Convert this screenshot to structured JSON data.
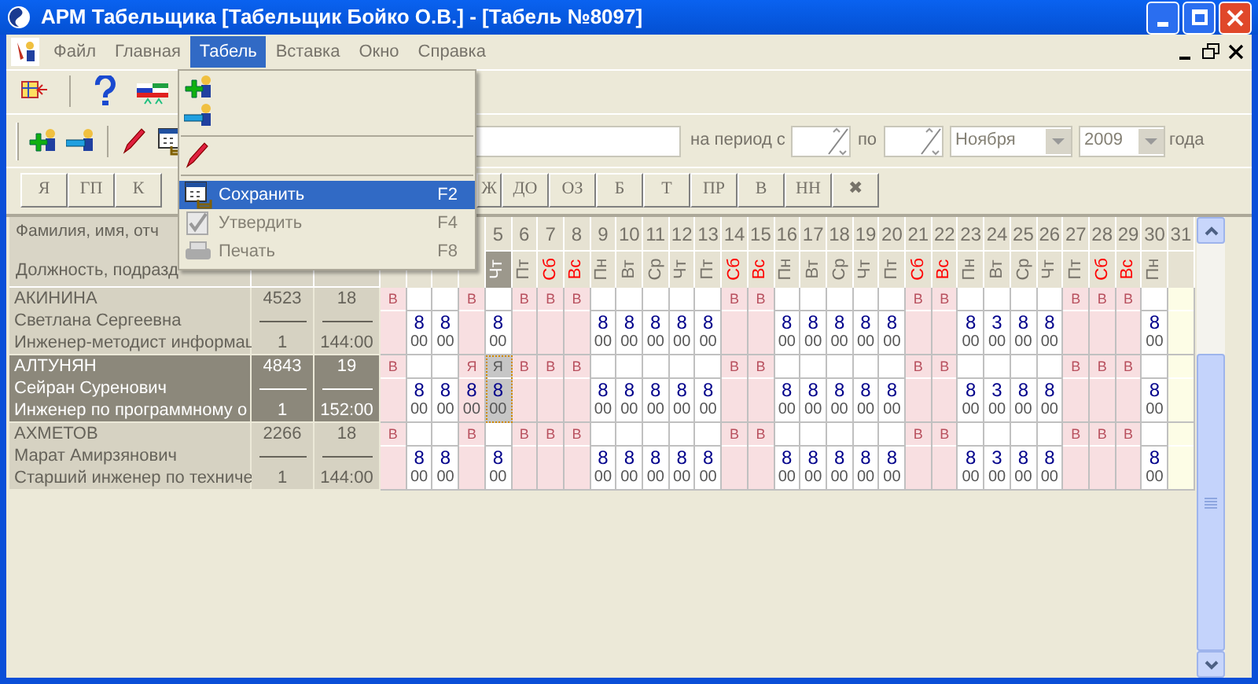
{
  "window": {
    "title": "АРМ Табельщика [Табельщик Бойко О.В.] - [Табель №8097]"
  },
  "menu": [
    {
      "label": "Файл",
      "selected": false
    },
    {
      "label": "Главная",
      "selected": false
    },
    {
      "label": "Табель",
      "selected": true
    },
    {
      "label": "Вставка",
      "selected": false
    },
    {
      "label": "Окно",
      "selected": false
    },
    {
      "label": "Справка",
      "selected": false
    }
  ],
  "dropdown": {
    "items": [
      {
        "kind": "item",
        "selected": false
      },
      {
        "kind": "item",
        "selected": false
      },
      {
        "kind": "separator"
      },
      {
        "kind": "item",
        "selected": false
      },
      {
        "kind": "separator"
      },
      {
        "kind": "item",
        "label": "Сохранить",
        "shortcut": "F2",
        "selected": true,
        "disabled": false
      },
      {
        "kind": "item",
        "label": "Утвердить",
        "shortcut": "F4",
        "selected": false,
        "disabled": true
      },
      {
        "kind": "item",
        "label": "Печать",
        "shortcut": "F8",
        "selected": false,
        "disabled": true
      }
    ]
  },
  "period": {
    "from_label": "на период с",
    "to_label": "по",
    "month": "Ноября",
    "year": "2009",
    "suffix": "года"
  },
  "codes_left": [
    "Я",
    "ГП",
    "К"
  ],
  "codes_right": [
    "Ж",
    "ДО",
    "ОЗ",
    "Б",
    "Т",
    "ПР",
    "В",
    "НН",
    "✖"
  ],
  "grid": {
    "header": {
      "name_label": "Фамилия, имя, отч",
      "position_label": "Должность, подразд",
      "days": [
        {
          "day": "5",
          "weekday": "Чт",
          "weekend": false,
          "selected": true
        },
        {
          "day": "6",
          "weekday": "Пт",
          "weekend": false,
          "selected": false
        },
        {
          "day": "7",
          "weekday": "Сб",
          "weekend": true,
          "selected": false
        },
        {
          "day": "8",
          "weekday": "Вс",
          "weekend": true,
          "selected": false
        },
        {
          "day": "9",
          "weekday": "Пн",
          "weekend": false,
          "selected": false
        },
        {
          "day": "10",
          "weekday": "Вт",
          "weekend": false,
          "selected": false
        },
        {
          "day": "11",
          "weekday": "Ср",
          "weekend": false,
          "selected": false
        },
        {
          "day": "12",
          "weekday": "Чт",
          "weekend": false,
          "selected": false
        },
        {
          "day": "13",
          "weekday": "Пт",
          "weekend": false,
          "selected": false
        },
        {
          "day": "14",
          "weekday": "Сб",
          "weekend": true,
          "selected": false
        },
        {
          "day": "15",
          "weekday": "Вс",
          "weekend": true,
          "selected": false
        },
        {
          "day": "16",
          "weekday": "Пн",
          "weekend": false,
          "selected": false
        },
        {
          "day": "17",
          "weekday": "Вт",
          "weekend": false,
          "selected": false
        },
        {
          "day": "18",
          "weekday": "Ср",
          "weekend": false,
          "selected": false
        },
        {
          "day": "19",
          "weekday": "Чт",
          "weekend": false,
          "selected": false
        },
        {
          "day": "20",
          "weekday": "Пт",
          "weekend": false,
          "selected": false
        },
        {
          "day": "21",
          "weekday": "Сб",
          "weekend": true,
          "selected": false
        },
        {
          "day": "22",
          "weekday": "Вс",
          "weekend": true,
          "selected": false
        },
        {
          "day": "23",
          "weekday": "Пн",
          "weekend": false,
          "selected": false
        },
        {
          "day": "24",
          "weekday": "Вт",
          "weekend": false,
          "selected": false
        },
        {
          "day": "25",
          "weekday": "Ср",
          "weekend": false,
          "selected": false
        },
        {
          "day": "26",
          "weekday": "Чт",
          "weekend": false,
          "selected": false
        },
        {
          "day": "27",
          "weekday": "Пт",
          "weekend": false,
          "selected": false
        },
        {
          "day": "28",
          "weekday": "Сб",
          "weekend": true,
          "selected": false
        },
        {
          "day": "29",
          "weekday": "Вс",
          "weekend": true,
          "selected": false
        },
        {
          "day": "30",
          "weekday": "Пн",
          "weekend": false,
          "selected": false
        },
        {
          "day": "31",
          "selected": false
        }
      ]
    },
    "employees": [
      {
        "surname": "АКИНИНА",
        "name": "Светлана Сергеевна",
        "position": "Инженер-методист информац",
        "tab_number": "4523",
        "rate": "1",
        "days": "18",
        "hours": "144:00",
        "selected": false,
        "cells": [
          {
            "kind": "off",
            "mark": "В",
            "selected": false
          },
          {
            "kind": "work",
            "hours": "8",
            "minutes": "00",
            "selected": false
          },
          {
            "kind": "work",
            "hours": "8",
            "minutes": "00",
            "selected": false
          },
          {
            "kind": "off",
            "mark": "В",
            "selected": false
          },
          {
            "kind": "work",
            "hours": "8",
            "minutes": "00",
            "selected": false
          },
          {
            "kind": "off",
            "mark": "В",
            "selected": false
          },
          {
            "kind": "off",
            "mark": "В",
            "selected": false
          },
          {
            "kind": "off",
            "mark": "В",
            "selected": false
          },
          {
            "kind": "work",
            "hours": "8",
            "minutes": "00",
            "selected": false
          },
          {
            "kind": "work",
            "hours": "8",
            "minutes": "00",
            "selected": false
          },
          {
            "kind": "work",
            "hours": "8",
            "minutes": "00",
            "selected": false
          },
          {
            "kind": "work",
            "hours": "8",
            "minutes": "00",
            "selected": false
          },
          {
            "kind": "work",
            "hours": "8",
            "minutes": "00",
            "selected": false
          },
          {
            "kind": "off",
            "mark": "В",
            "selected": false
          },
          {
            "kind": "off",
            "mark": "В",
            "selected": false
          },
          {
            "kind": "work",
            "hours": "8",
            "minutes": "00",
            "selected": false
          },
          {
            "kind": "work",
            "hours": "8",
            "minutes": "00",
            "selected": false
          },
          {
            "kind": "work",
            "hours": "8",
            "minutes": "00",
            "selected": false
          },
          {
            "kind": "work",
            "hours": "8",
            "minutes": "00",
            "selected": false
          },
          {
            "kind": "work",
            "hours": "8",
            "minutes": "00",
            "selected": false
          },
          {
            "kind": "off",
            "mark": "В",
            "selected": false
          },
          {
            "kind": "off",
            "mark": "В",
            "selected": false
          },
          {
            "kind": "work",
            "hours": "8",
            "minutes": "00",
            "selected": false
          },
          {
            "kind": "work",
            "hours": "3",
            "minutes": "00",
            "selected": false
          },
          {
            "kind": "work",
            "hours": "8",
            "minutes": "00",
            "selected": false
          },
          {
            "kind": "work",
            "hours": "8",
            "minutes": "00",
            "selected": false
          },
          {
            "kind": "off",
            "mark": "В",
            "selected": false
          },
          {
            "kind": "off",
            "mark": "В",
            "selected": false
          },
          {
            "kind": "off",
            "mark": "В",
            "selected": false
          },
          {
            "kind": "work",
            "hours": "8",
            "minutes": "00",
            "selected": false
          },
          {
            "kind": "none",
            "selected": false
          }
        ]
      },
      {
        "surname": "АЛТУНЯН",
        "name": "Сейран Суренович",
        "position": "Инженер по программному о",
        "tab_number": "4843",
        "rate": "1",
        "days": "19",
        "hours": "152:00",
        "selected": true,
        "cells": [
          {
            "kind": "off",
            "mark": "В",
            "selected": false
          },
          {
            "kind": "work",
            "hours": "8",
            "minutes": "00",
            "selected": false
          },
          {
            "kind": "work",
            "hours": "8",
            "minutes": "00",
            "selected": false
          },
          {
            "kind": "off",
            "mark": "Я",
            "hours": "8",
            "minutes": "00",
            "selected": false
          },
          {
            "kind": "work",
            "mark": "Я",
            "hours": "8",
            "minutes": "00",
            "selected": true
          },
          {
            "kind": "off",
            "mark": "В",
            "selected": false
          },
          {
            "kind": "off",
            "mark": "В",
            "selected": false
          },
          {
            "kind": "off",
            "mark": "В",
            "selected": false
          },
          {
            "kind": "work",
            "hours": "8",
            "minutes": "00",
            "selected": false
          },
          {
            "kind": "work",
            "hours": "8",
            "minutes": "00",
            "selected": false
          },
          {
            "kind": "work",
            "hours": "8",
            "minutes": "00",
            "selected": false
          },
          {
            "kind": "work",
            "hours": "8",
            "minutes": "00",
            "selected": false
          },
          {
            "kind": "work",
            "hours": "8",
            "minutes": "00",
            "selected": false
          },
          {
            "kind": "off",
            "mark": "В",
            "selected": false
          },
          {
            "kind": "off",
            "mark": "В",
            "selected": false
          },
          {
            "kind": "work",
            "hours": "8",
            "minutes": "00",
            "selected": false
          },
          {
            "kind": "work",
            "hours": "8",
            "minutes": "00",
            "selected": false
          },
          {
            "kind": "work",
            "hours": "8",
            "minutes": "00",
            "selected": false
          },
          {
            "kind": "work",
            "hours": "8",
            "minutes": "00",
            "selected": false
          },
          {
            "kind": "work",
            "hours": "8",
            "minutes": "00",
            "selected": false
          },
          {
            "kind": "off",
            "mark": "В",
            "selected": false
          },
          {
            "kind": "off",
            "mark": "В",
            "selected": false
          },
          {
            "kind": "work",
            "hours": "8",
            "minutes": "00",
            "selected": false
          },
          {
            "kind": "work",
            "hours": "3",
            "minutes": "00",
            "selected": false
          },
          {
            "kind": "work",
            "hours": "8",
            "minutes": "00",
            "selected": false
          },
          {
            "kind": "work",
            "hours": "8",
            "minutes": "00",
            "selected": false
          },
          {
            "kind": "off",
            "mark": "В",
            "selected": false
          },
          {
            "kind": "off",
            "mark": "В",
            "selected": false
          },
          {
            "kind": "off",
            "mark": "В",
            "selected": false
          },
          {
            "kind": "work",
            "hours": "8",
            "minutes": "00",
            "selected": false
          },
          {
            "kind": "none",
            "selected": false
          }
        ]
      },
      {
        "surname": "АХМЕТОВ",
        "name": "Марат Амирзянович",
        "position": "Старший инженер по техниче",
        "tab_number": "2266",
        "rate": "1",
        "days": "18",
        "hours": "144:00",
        "selected": false,
        "cells": [
          {
            "kind": "off",
            "mark": "В",
            "selected": false
          },
          {
            "kind": "work",
            "hours": "8",
            "minutes": "00",
            "selected": false
          },
          {
            "kind": "work",
            "hours": "8",
            "minutes": "00",
            "selected": false
          },
          {
            "kind": "off",
            "mark": "В",
            "selected": false
          },
          {
            "kind": "work",
            "hours": "8",
            "minutes": "00",
            "selected": false
          },
          {
            "kind": "off",
            "mark": "В",
            "selected": false
          },
          {
            "kind": "off",
            "mark": "В",
            "selected": false
          },
          {
            "kind": "off",
            "mark": "В",
            "selected": false
          },
          {
            "kind": "work",
            "hours": "8",
            "minutes": "00",
            "selected": false
          },
          {
            "kind": "work",
            "hours": "8",
            "minutes": "00",
            "selected": false
          },
          {
            "kind": "work",
            "hours": "8",
            "minutes": "00",
            "selected": false
          },
          {
            "kind": "work",
            "hours": "8",
            "minutes": "00",
            "selected": false
          },
          {
            "kind": "work",
            "hours": "8",
            "minutes": "00",
            "selected": false
          },
          {
            "kind": "off",
            "mark": "В",
            "selected": false
          },
          {
            "kind": "off",
            "mark": "В",
            "selected": false
          },
          {
            "kind": "work",
            "hours": "8",
            "minutes": "00",
            "selected": false
          },
          {
            "kind": "work",
            "hours": "8",
            "minutes": "00",
            "selected": false
          },
          {
            "kind": "work",
            "hours": "8",
            "minutes": "00",
            "selected": false
          },
          {
            "kind": "work",
            "hours": "8",
            "minutes": "00",
            "selected": false
          },
          {
            "kind": "work",
            "hours": "8",
            "minutes": "00",
            "selected": false
          },
          {
            "kind": "off",
            "mark": "В",
            "selected": false
          },
          {
            "kind": "off",
            "mark": "В",
            "selected": false
          },
          {
            "kind": "work",
            "hours": "8",
            "minutes": "00",
            "selected": false
          },
          {
            "kind": "work",
            "hours": "3",
            "minutes": "00",
            "selected": false
          },
          {
            "kind": "work",
            "hours": "8",
            "minutes": "00",
            "selected": false
          },
          {
            "kind": "work",
            "hours": "8",
            "minutes": "00",
            "selected": false
          },
          {
            "kind": "off",
            "mark": "В",
            "selected": false
          },
          {
            "kind": "off",
            "mark": "В",
            "selected": false
          },
          {
            "kind": "off",
            "mark": "В",
            "selected": false
          },
          {
            "kind": "work",
            "hours": "8",
            "minutes": "00",
            "selected": false
          },
          {
            "kind": "none",
            "selected": false
          }
        ]
      }
    ]
  }
}
